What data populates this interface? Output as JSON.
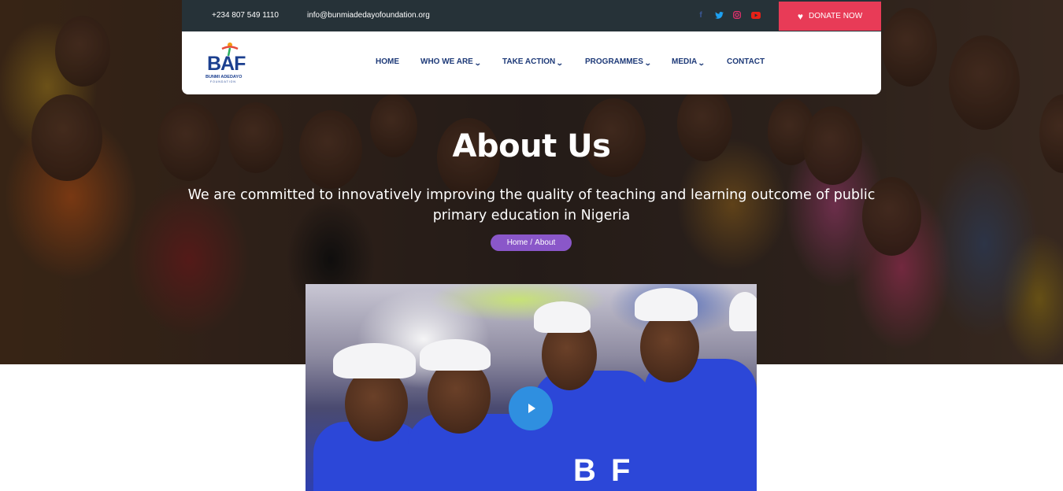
{
  "topbar": {
    "phone": "+234 807 549 1110",
    "email": "info@bunmiadedayofoundation.org",
    "social": [
      {
        "icon": "facebook-icon",
        "glyph": "f",
        "color": "#3b5998"
      },
      {
        "icon": "twitter-icon",
        "glyph": "t",
        "color": "#1da1f2"
      },
      {
        "icon": "instagram-icon",
        "glyph": "◎",
        "color": "#e1306c"
      },
      {
        "icon": "youtube-icon",
        "glyph": "▶",
        "color": "#e62117"
      }
    ],
    "donate_label": "DONATE NOW"
  },
  "logo": {
    "letters": "BAF",
    "name": "BUNMI ADEDAYO",
    "sub": "FOUNDATION"
  },
  "nav": {
    "items": [
      {
        "label": "HOME",
        "has_dropdown": false
      },
      {
        "label": "WHO WE ARE",
        "has_dropdown": true
      },
      {
        "label": "TAKE ACTION",
        "has_dropdown": true
      },
      {
        "label": "PROGRAMMES",
        "has_dropdown": true
      },
      {
        "label": "MEDIA",
        "has_dropdown": true
      },
      {
        "label": "CONTACT",
        "has_dropdown": false
      }
    ]
  },
  "hero": {
    "title": "About Us",
    "subtitle": "We are committed to innovatively improving the quality of teaching and learning outcome of public primary education in Nigeria",
    "breadcrumb": {
      "home": "Home",
      "separator": "/",
      "current": "About"
    }
  },
  "colors": {
    "topbar_bg": "#263238",
    "donate_bg": "#e83b57",
    "nav_text": "#1e3a78",
    "breadcrumb_bg": "#8a57c9",
    "play_button": "#2f8fe0"
  }
}
